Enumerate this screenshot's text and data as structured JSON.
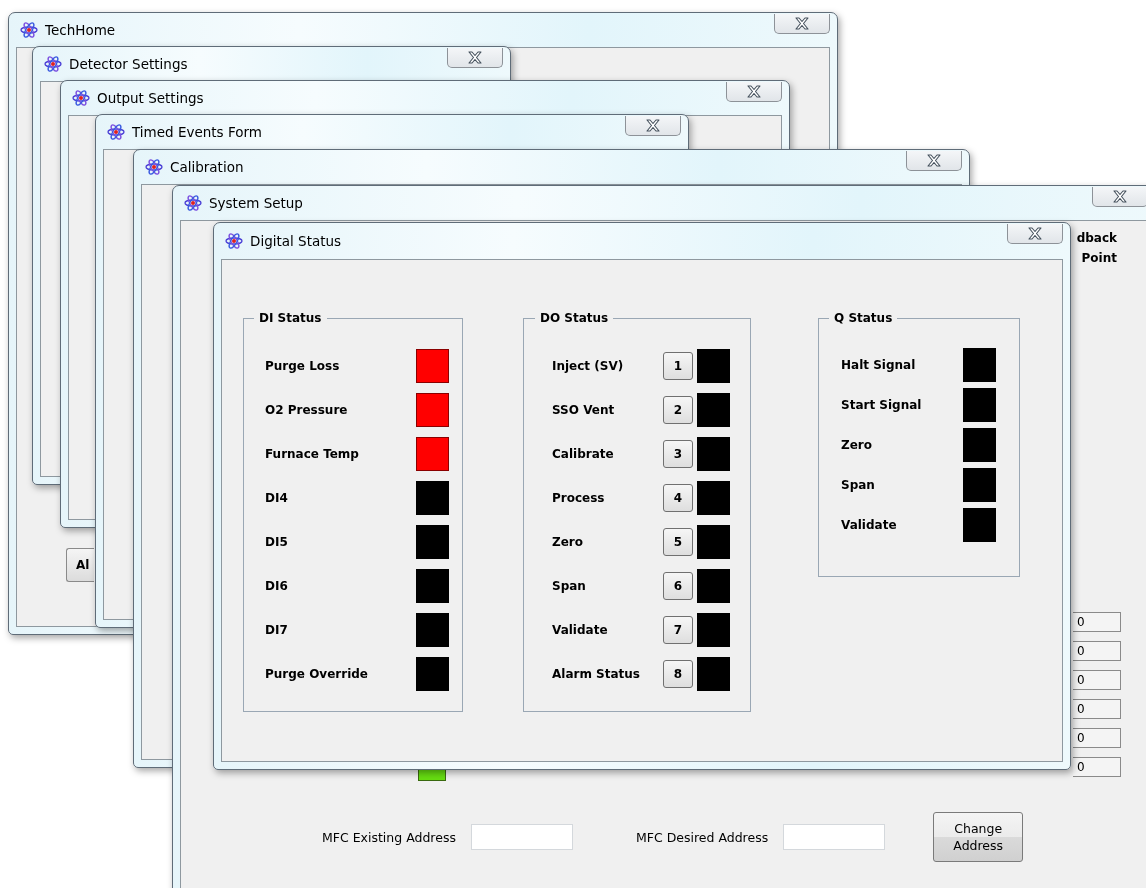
{
  "windows": [
    {
      "kind": "techhome",
      "title": "TechHome",
      "buttons": [
        "Al"
      ]
    },
    {
      "kind": "plain",
      "title": "Detector Settings"
    },
    {
      "kind": "plain",
      "title": "Output Settings"
    },
    {
      "kind": "plain",
      "title": "Timed Events Form"
    },
    {
      "kind": "plain",
      "title": "Calibration"
    },
    {
      "kind": "system_setup",
      "title": "System Setup",
      "column_headers": [
        "dback",
        "Point"
      ],
      "value_fields": [
        "0",
        "0",
        "0",
        "0",
        "0",
        "0"
      ],
      "indicator": {
        "on": true
      },
      "mfc_existing_address": {
        "label": "MFC Existing Address"
      },
      "mfc_desired_address": {
        "label": "MFC Desired Address"
      },
      "change_address_button": "Change Address"
    },
    {
      "kind": "digital_status",
      "title": "Digital Status",
      "groups": [
        {
          "title": "DI Status",
          "rows": [
            {
              "label": "Purge Loss",
              "on": true
            },
            {
              "label": "O2 Pressure",
              "on": true
            },
            {
              "label": "Furnace Temp",
              "on": true
            },
            {
              "label": "DI4",
              "on": false
            },
            {
              "label": "DI5",
              "on": false
            },
            {
              "label": "DI6",
              "on": false
            },
            {
              "label": "DI7",
              "on": false
            },
            {
              "label": "Purge Override",
              "on": false
            }
          ]
        },
        {
          "title": "DO Status",
          "rows": [
            {
              "label": "Inject (SV)",
              "button": "1",
              "on": false
            },
            {
              "label": "SSO Vent",
              "button": "2",
              "on": false
            },
            {
              "label": "Calibrate",
              "button": "3",
              "on": false
            },
            {
              "label": "Process",
              "button": "4",
              "on": false
            },
            {
              "label": "Zero",
              "button": "5",
              "on": false
            },
            {
              "label": "Span",
              "button": "6",
              "on": false
            },
            {
              "label": "Validate",
              "button": "7",
              "on": false
            },
            {
              "label": "Alarm Status",
              "button": "8",
              "on": false
            }
          ]
        },
        {
          "title": "Q Status",
          "rows": [
            {
              "label": "Halt Signal",
              "on": false
            },
            {
              "label": "Start Signal",
              "on": false
            },
            {
              "label": "Zero",
              "on": false
            },
            {
              "label": "Span",
              "on": false
            },
            {
              "label": "Validate",
              "on": false
            }
          ]
        }
      ]
    }
  ]
}
